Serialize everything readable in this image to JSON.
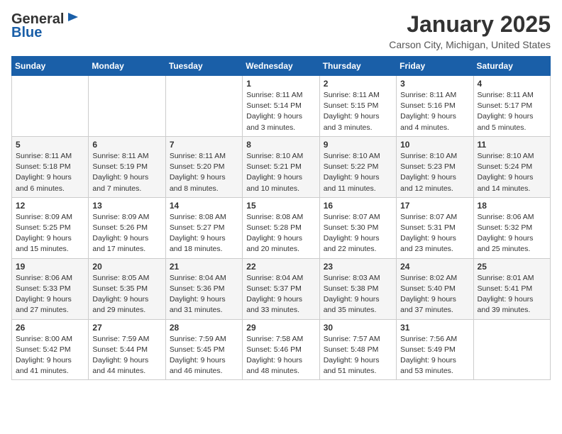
{
  "header": {
    "logo": {
      "line1": "General",
      "line2": "Blue"
    },
    "title": "January 2025",
    "location": "Carson City, Michigan, United States"
  },
  "weekdays": [
    "Sunday",
    "Monday",
    "Tuesday",
    "Wednesday",
    "Thursday",
    "Friday",
    "Saturday"
  ],
  "weeks": [
    [
      {
        "day": "",
        "info": ""
      },
      {
        "day": "",
        "info": ""
      },
      {
        "day": "",
        "info": ""
      },
      {
        "day": "1",
        "info": "Sunrise: 8:11 AM\nSunset: 5:14 PM\nDaylight: 9 hours\nand 3 minutes."
      },
      {
        "day": "2",
        "info": "Sunrise: 8:11 AM\nSunset: 5:15 PM\nDaylight: 9 hours\nand 3 minutes."
      },
      {
        "day": "3",
        "info": "Sunrise: 8:11 AM\nSunset: 5:16 PM\nDaylight: 9 hours\nand 4 minutes."
      },
      {
        "day": "4",
        "info": "Sunrise: 8:11 AM\nSunset: 5:17 PM\nDaylight: 9 hours\nand 5 minutes."
      }
    ],
    [
      {
        "day": "5",
        "info": "Sunrise: 8:11 AM\nSunset: 5:18 PM\nDaylight: 9 hours\nand 6 minutes."
      },
      {
        "day": "6",
        "info": "Sunrise: 8:11 AM\nSunset: 5:19 PM\nDaylight: 9 hours\nand 7 minutes."
      },
      {
        "day": "7",
        "info": "Sunrise: 8:11 AM\nSunset: 5:20 PM\nDaylight: 9 hours\nand 8 minutes."
      },
      {
        "day": "8",
        "info": "Sunrise: 8:10 AM\nSunset: 5:21 PM\nDaylight: 9 hours\nand 10 minutes."
      },
      {
        "day": "9",
        "info": "Sunrise: 8:10 AM\nSunset: 5:22 PM\nDaylight: 9 hours\nand 11 minutes."
      },
      {
        "day": "10",
        "info": "Sunrise: 8:10 AM\nSunset: 5:23 PM\nDaylight: 9 hours\nand 12 minutes."
      },
      {
        "day": "11",
        "info": "Sunrise: 8:10 AM\nSunset: 5:24 PM\nDaylight: 9 hours\nand 14 minutes."
      }
    ],
    [
      {
        "day": "12",
        "info": "Sunrise: 8:09 AM\nSunset: 5:25 PM\nDaylight: 9 hours\nand 15 minutes."
      },
      {
        "day": "13",
        "info": "Sunrise: 8:09 AM\nSunset: 5:26 PM\nDaylight: 9 hours\nand 17 minutes."
      },
      {
        "day": "14",
        "info": "Sunrise: 8:08 AM\nSunset: 5:27 PM\nDaylight: 9 hours\nand 18 minutes."
      },
      {
        "day": "15",
        "info": "Sunrise: 8:08 AM\nSunset: 5:28 PM\nDaylight: 9 hours\nand 20 minutes."
      },
      {
        "day": "16",
        "info": "Sunrise: 8:07 AM\nSunset: 5:30 PM\nDaylight: 9 hours\nand 22 minutes."
      },
      {
        "day": "17",
        "info": "Sunrise: 8:07 AM\nSunset: 5:31 PM\nDaylight: 9 hours\nand 23 minutes."
      },
      {
        "day": "18",
        "info": "Sunrise: 8:06 AM\nSunset: 5:32 PM\nDaylight: 9 hours\nand 25 minutes."
      }
    ],
    [
      {
        "day": "19",
        "info": "Sunrise: 8:06 AM\nSunset: 5:33 PM\nDaylight: 9 hours\nand 27 minutes."
      },
      {
        "day": "20",
        "info": "Sunrise: 8:05 AM\nSunset: 5:35 PM\nDaylight: 9 hours\nand 29 minutes."
      },
      {
        "day": "21",
        "info": "Sunrise: 8:04 AM\nSunset: 5:36 PM\nDaylight: 9 hours\nand 31 minutes."
      },
      {
        "day": "22",
        "info": "Sunrise: 8:04 AM\nSunset: 5:37 PM\nDaylight: 9 hours\nand 33 minutes."
      },
      {
        "day": "23",
        "info": "Sunrise: 8:03 AM\nSunset: 5:38 PM\nDaylight: 9 hours\nand 35 minutes."
      },
      {
        "day": "24",
        "info": "Sunrise: 8:02 AM\nSunset: 5:40 PM\nDaylight: 9 hours\nand 37 minutes."
      },
      {
        "day": "25",
        "info": "Sunrise: 8:01 AM\nSunset: 5:41 PM\nDaylight: 9 hours\nand 39 minutes."
      }
    ],
    [
      {
        "day": "26",
        "info": "Sunrise: 8:00 AM\nSunset: 5:42 PM\nDaylight: 9 hours\nand 41 minutes."
      },
      {
        "day": "27",
        "info": "Sunrise: 7:59 AM\nSunset: 5:44 PM\nDaylight: 9 hours\nand 44 minutes."
      },
      {
        "day": "28",
        "info": "Sunrise: 7:59 AM\nSunset: 5:45 PM\nDaylight: 9 hours\nand 46 minutes."
      },
      {
        "day": "29",
        "info": "Sunrise: 7:58 AM\nSunset: 5:46 PM\nDaylight: 9 hours\nand 48 minutes."
      },
      {
        "day": "30",
        "info": "Sunrise: 7:57 AM\nSunset: 5:48 PM\nDaylight: 9 hours\nand 51 minutes."
      },
      {
        "day": "31",
        "info": "Sunrise: 7:56 AM\nSunset: 5:49 PM\nDaylight: 9 hours\nand 53 minutes."
      },
      {
        "day": "",
        "info": ""
      }
    ]
  ]
}
